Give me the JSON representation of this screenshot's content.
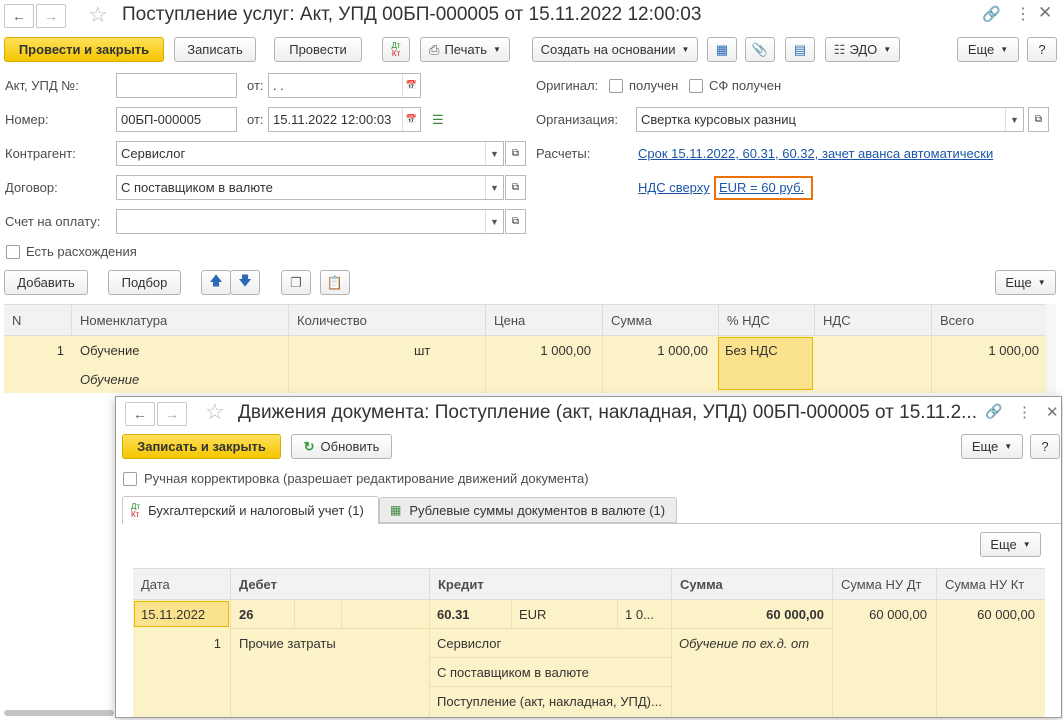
{
  "main": {
    "title": "Поступление услуг: Акт, УПД 00БП-000005 от 15.11.2022 12:00:03",
    "toolbar": {
      "post_close": "Провести и закрыть",
      "save": "Записать",
      "post": "Провести",
      "print": "Печать",
      "create_based": "Создать на основании",
      "edo": "ЭДО",
      "more": "Еще",
      "help": "?"
    },
    "form": {
      "act_label": "Акт, УПД №:",
      "act_value": "",
      "from_label": "от:",
      "act_date_placeholder": " .  .",
      "number_label": "Номер:",
      "number_value": "00БП-000005",
      "number_date": "15.11.2022 12:00:03",
      "contractor_label": "Контрагент:",
      "contractor_value": "Сервислог",
      "contract_label": "Договор:",
      "contract_value": "С поставщиком в валюте",
      "invoice_label": "Счет на оплату:",
      "invoice_value": "",
      "discrepancy_label": "Есть расхождения",
      "original_label": "Оригинал:",
      "received_label": "получен",
      "sf_received_label": "СФ получен",
      "org_label": "Организация:",
      "org_value": "Свертка курсовых разниц",
      "settlements_label": "Расчеты:",
      "settlements_link": "Срок 15.11.2022, 60.31, 60.32, зачет аванса автоматически",
      "vat_link": "НДС сверху",
      "rate_link": "EUR = 60 руб."
    },
    "table_toolbar": {
      "add": "Добавить",
      "select": "Подбор",
      "more": "Еще"
    },
    "table": {
      "headers": [
        "N",
        "Номенклатура",
        "Количество",
        "Цена",
        "Сумма",
        "% НДС",
        "НДС",
        "Всего"
      ],
      "row": {
        "n": "1",
        "item": "Обучение",
        "item_sub": "Обучение",
        "unit": "шт",
        "price": "1 000,00",
        "sum": "1 000,00",
        "vat_rate": "Без НДС",
        "vat": "",
        "total": "1 000,00"
      }
    }
  },
  "movements": {
    "title": "Движения документа: Поступление (акт, накладная, УПД) 00БП-000005 от 15.11.2...",
    "toolbar": {
      "save_close": "Записать и закрыть",
      "refresh": "Обновить",
      "more": "Еще",
      "help": "?"
    },
    "manual_label": "Ручная корректировка (разрешает редактирование движений документа)",
    "tabs": [
      {
        "label": "Бухгалтерский и налоговый учет (1)",
        "icon": "dt-kt-icon"
      },
      {
        "label": "Рублевые суммы документов в валюте (1)",
        "icon": "table-icon"
      }
    ],
    "more": "Еще",
    "headers": [
      "Дата",
      "Дебет",
      "Кредит",
      "Сумма",
      "Сумма НУ Дт",
      "Сумма НУ Кт"
    ],
    "row": {
      "date": "15.11.2022",
      "n": "1",
      "debit_account": "26",
      "debit_sub1": "Прочие затраты",
      "credit_account": "60.31",
      "credit_currency": "EUR",
      "credit_amount": "1 0...",
      "credit_sub1": "Сервислог",
      "credit_sub2": "С поставщиком в валюте",
      "credit_sub3": "Поступление (акт, накладная, УПД)...",
      "sum": "60 000,00",
      "sum_comment": "Обучение по ех.д.  от",
      "sum_nu_dt": "60 000,00",
      "sum_nu_kt": "60 000,00"
    }
  },
  "colors": {
    "accent_yellow": "#f5c600",
    "row_highlight": "#fcf2c8",
    "link_blue": "#1b56a7",
    "focus_orange": "#e8720c"
  }
}
